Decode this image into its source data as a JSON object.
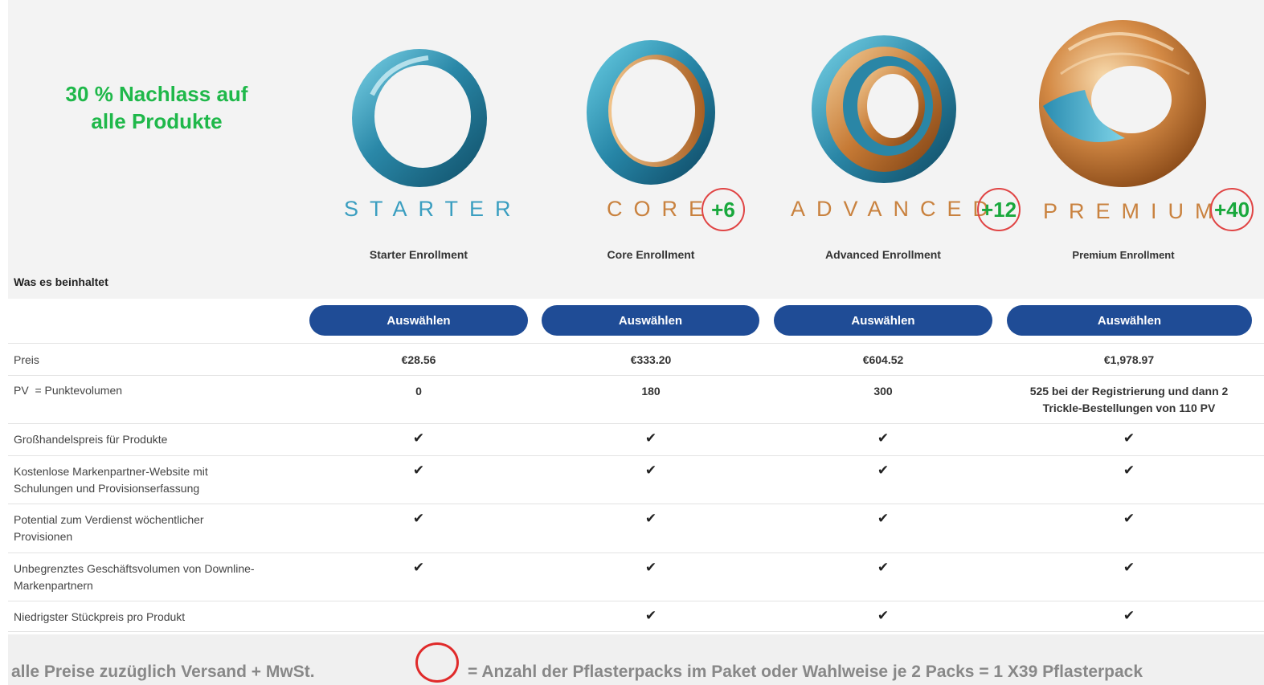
{
  "promo": {
    "text": "30 % Nachlass auf\nalle Produkte"
  },
  "includes_label": "Was es beinhaltet",
  "plans": [
    {
      "name": "STARTER",
      "enrollment": "Starter Enrollment",
      "badge": "",
      "button": "Auswählen",
      "price": "€28.56",
      "pv": "0"
    },
    {
      "name": "CORE",
      "enrollment": "Core Enrollment",
      "badge": "+6",
      "button": "Auswählen",
      "price": "€333.20",
      "pv": "180"
    },
    {
      "name": "ADVANCED",
      "enrollment": "Advanced Enrollment",
      "badge": "+12",
      "button": "Auswählen",
      "price": "€604.52",
      "pv": "300"
    },
    {
      "name": "PREMIUM",
      "enrollment": "Premium Enrollment",
      "badge": "+40",
      "button": "Auswählen",
      "price": "€1,978.97",
      "pv": "525 bei der Registrierung und dann 2 Trickle-Bestellungen von 110 PV"
    }
  ],
  "rows": {
    "price": "Preis",
    "pv": "PV  = Punktevolumen",
    "wholesale": "Großhandelspreis für Produkte",
    "website": "Kostenlose Markenpartner-Website mit Schulungen und Provisionserfassung",
    "weekly": "Potential zum Verdienst wöchentlicher Provisionen",
    "unlimited": "Unbegrenztes Geschäftsvolumen von Downline-Markenpartnern",
    "lowest": "Niedrigster Stückpreis pro Produkt"
  },
  "check_glyph": "✔",
  "footer": {
    "left": "alle Preise zuzüglich Versand + MwSt.",
    "right": "= Anzahl der Pflasterpacks im Paket  oder Wahlweise je 2 Packs = 1  X39 Pflasterpack"
  },
  "colors": {
    "accent_button": "#1f4c96",
    "promo_green": "#1fb84a",
    "badge_red": "#e04444",
    "teal": "#2f9ab8",
    "copper": "#c9823f"
  }
}
